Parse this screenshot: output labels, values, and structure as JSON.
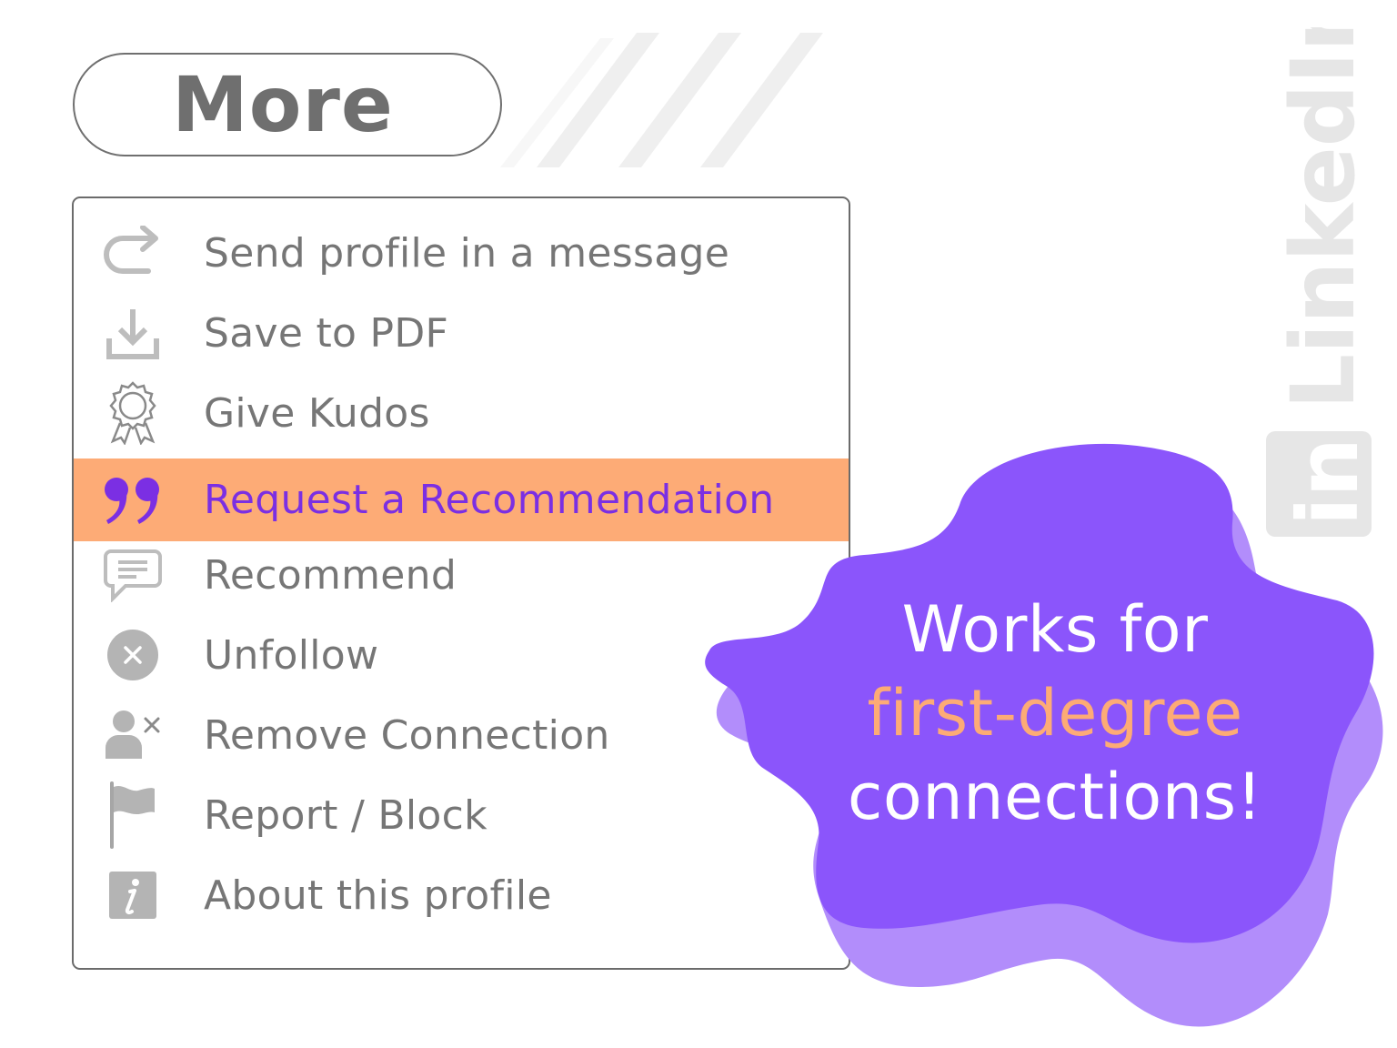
{
  "more_button": {
    "label": "More"
  },
  "menu": {
    "items": [
      {
        "label": "Send profile in a message",
        "icon": "share-arrow-icon",
        "highlighted": false
      },
      {
        "label": "Save to PDF",
        "icon": "download-icon",
        "highlighted": false
      },
      {
        "label": "Give Kudos",
        "icon": "award-badge-icon",
        "highlighted": false
      },
      {
        "label": "Request a Recommendation",
        "icon": "quote-icon",
        "highlighted": true
      },
      {
        "label": "Recommend",
        "icon": "chat-bubble-icon",
        "highlighted": false
      },
      {
        "label": "Unfollow",
        "icon": "close-circle-icon",
        "highlighted": false
      },
      {
        "label": "Remove Connection",
        "icon": "remove-user-icon",
        "highlighted": false
      },
      {
        "label": "Report / Block",
        "icon": "flag-icon",
        "highlighted": false
      },
      {
        "label": "About this profile",
        "icon": "info-icon",
        "highlighted": false
      }
    ]
  },
  "callout": {
    "line1": "Works for",
    "line2": "first-degree",
    "line3": "connections!"
  },
  "brand": {
    "name": "LinkedIn",
    "badge": "in"
  },
  "colors": {
    "highlight_bg": "#fdab76",
    "highlight_text": "#7b2fe3",
    "blob": "#8b55fb",
    "blob_shadow": "#b28dfb",
    "text_gray": "#767676"
  }
}
